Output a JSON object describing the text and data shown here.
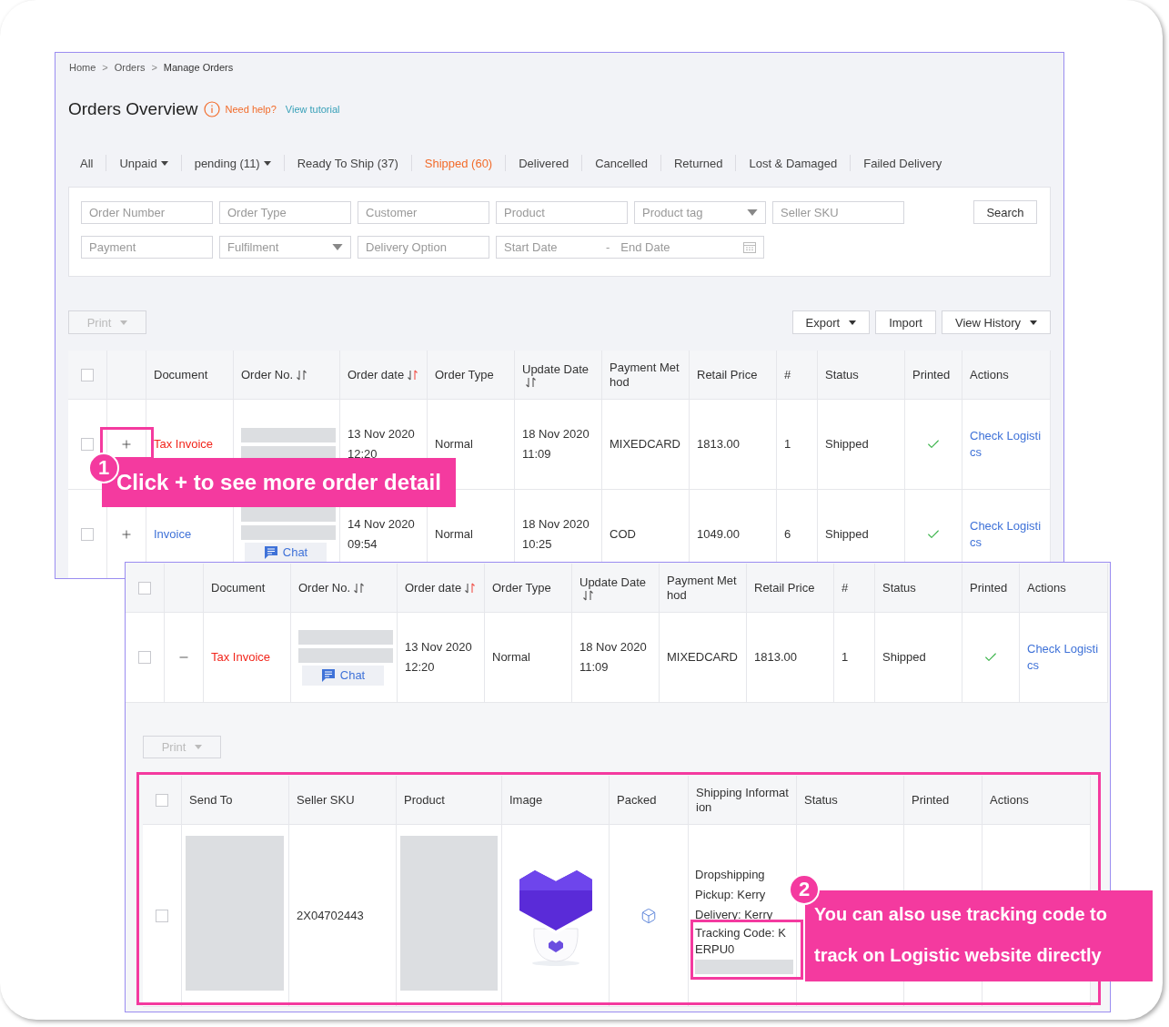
{
  "callouts": [
    {
      "number": "1",
      "text": "Click + to see more order detail"
    },
    {
      "number": "2",
      "text": "You can also use tracking code to track on Logistic website directly"
    }
  ],
  "orders_page": {
    "breadcrumb": [
      {
        "label": "Home",
        "kind": "link"
      },
      {
        "label": ">",
        "kind": "separator"
      },
      {
        "label": "Orders",
        "kind": "link"
      },
      {
        "label": ">",
        "kind": "separator"
      },
      {
        "label": "Manage Orders",
        "kind": "current"
      }
    ],
    "title": "Orders Overview",
    "help_text": "Need help?",
    "tutorial_link": "View tutorial",
    "tabs": [
      {
        "label": "All",
        "selected": false,
        "dropdown": false
      },
      {
        "label": "Unpaid",
        "selected": false,
        "dropdown": true
      },
      {
        "label": "pending (11)",
        "selected": false,
        "dropdown": true
      },
      {
        "label": "Ready To Ship (37)",
        "selected": false,
        "dropdown": false
      },
      {
        "label": "Shipped (60)",
        "selected": true,
        "dropdown": false
      },
      {
        "label": "Delivered",
        "selected": false,
        "dropdown": false
      },
      {
        "label": "Cancelled",
        "selected": false,
        "dropdown": false
      },
      {
        "label": "Returned",
        "selected": false,
        "dropdown": false
      },
      {
        "label": "Lost & Damaged",
        "selected": false,
        "dropdown": false
      },
      {
        "label": "Failed Delivery",
        "selected": false,
        "dropdown": false
      }
    ],
    "filters": [
      [
        {
          "kind": "text",
          "placeholder": "Order Number"
        },
        {
          "kind": "text",
          "placeholder": "Order Type"
        },
        {
          "kind": "text",
          "placeholder": "Customer"
        },
        {
          "kind": "text",
          "placeholder": "Product"
        },
        {
          "kind": "select",
          "placeholder": "Product tag"
        },
        {
          "kind": "text",
          "placeholder": "Seller SKU"
        }
      ],
      [
        {
          "kind": "text",
          "placeholder": "Payment"
        },
        {
          "kind": "select",
          "placeholder": "Fulfilment"
        },
        {
          "kind": "text",
          "placeholder": "Delivery Option"
        },
        {
          "kind": "date_range",
          "placeholder": "Start Date",
          "separator": "-",
          "end_placeholder": "End Date"
        }
      ]
    ],
    "search_button": "Search",
    "print_button": {
      "label": "Print",
      "disabled": true
    },
    "toolbar_buttons": [
      {
        "label": "Export",
        "dropdown": true
      },
      {
        "label": "Import",
        "dropdown": false
      },
      {
        "label": "View History",
        "dropdown": true
      }
    ],
    "table": {
      "columns": [
        {
          "kind": "checkbox",
          "checked": false
        },
        {
          "kind": "blank"
        },
        {
          "kind": "text",
          "label": "Document"
        },
        {
          "kind": "sortable",
          "label": "Order No.",
          "sorted": false
        },
        {
          "kind": "sortable",
          "label": "Order date",
          "sorted": true
        },
        {
          "kind": "text",
          "label": "Order Type"
        },
        {
          "kind": "sortable",
          "label": "Update Date",
          "sorted": false
        },
        {
          "kind": "text",
          "label": "Payment Method"
        },
        {
          "kind": "text",
          "label": "Retail Price"
        },
        {
          "kind": "text",
          "label": "#"
        },
        {
          "kind": "text",
          "label": "Status"
        },
        {
          "kind": "text",
          "label": "Printed"
        },
        {
          "kind": "text",
          "label": "Actions"
        }
      ],
      "rows": [
        {
          "checked": false,
          "expanded": false,
          "document": {
            "label": "Tax Invoice",
            "kind": "tax_invoice"
          },
          "order_date": [
            "13 Nov 2020",
            "12:20"
          ],
          "order_type": "Normal",
          "update_date": [
            "18 Nov 2020",
            "11:09"
          ],
          "payment": "MIXEDCARD",
          "price": "1813.00",
          "quantity": "1",
          "status": "Shipped",
          "printed": true,
          "action": "Check Logistics"
        },
        {
          "checked": false,
          "expanded": false,
          "document": {
            "label": "Invoice",
            "kind": "invoice"
          },
          "chat": "Chat",
          "order_date": [
            "14 Nov 2020",
            "09:54"
          ],
          "order_type": "Normal",
          "update_date": [
            "18 Nov 2020",
            "10:25"
          ],
          "payment": "COD",
          "price": "1049.00",
          "quantity": "6",
          "status": "Shipped",
          "printed": true,
          "action": "Check Logistics"
        }
      ]
    }
  },
  "expanded_view": {
    "table": {
      "columns": [
        {
          "kind": "checkbox",
          "checked": false
        },
        {
          "kind": "blank"
        },
        {
          "kind": "text",
          "label": "Document"
        },
        {
          "kind": "sortable",
          "label": "Order No.",
          "sorted": false
        },
        {
          "kind": "sortable",
          "label": "Order date",
          "sorted": true
        },
        {
          "kind": "text",
          "label": "Order Type"
        },
        {
          "kind": "sortable",
          "label": "Update Date",
          "sorted": false
        },
        {
          "kind": "text",
          "label": "Payment Method"
        },
        {
          "kind": "text",
          "label": "Retail Price"
        },
        {
          "kind": "text",
          "label": "#"
        },
        {
          "kind": "text",
          "label": "Status"
        },
        {
          "kind": "text",
          "label": "Printed"
        },
        {
          "kind": "text",
          "label": "Actions"
        }
      ],
      "rows": [
        {
          "checked": false,
          "expanded": true,
          "document": {
            "label": "Tax Invoice",
            "kind": "tax_invoice"
          },
          "chat": "Chat",
          "order_date": [
            "13 Nov 2020",
            "12:20"
          ],
          "order_type": "Normal",
          "update_date": [
            "18 Nov 2020",
            "11:09"
          ],
          "payment": "MIXEDCARD",
          "price": "1813.00",
          "quantity": "1",
          "status": "Shipped",
          "printed": true,
          "action": "Check Logistics"
        }
      ]
    },
    "print_button": {
      "label": "Print",
      "disabled": true
    },
    "items_table": {
      "columns": [
        {
          "kind": "checkbox",
          "checked": false
        },
        {
          "kind": "text",
          "label": "Send To"
        },
        {
          "kind": "text",
          "label": "Seller SKU"
        },
        {
          "kind": "text",
          "label": "Product"
        },
        {
          "kind": "text",
          "label": "Image"
        },
        {
          "kind": "text",
          "label": "Packed"
        },
        {
          "kind": "text",
          "label": "Shipping Information"
        },
        {
          "kind": "text",
          "label": "Status"
        },
        {
          "kind": "text",
          "label": "Printed"
        },
        {
          "kind": "text",
          "label": "Actions"
        }
      ],
      "rows": [
        {
          "checked": false,
          "seller_sku": "2X04702443",
          "image": {
            "kind": "picture"
          },
          "packed": true,
          "shipping_info": [
            "Dropshipping",
            "Pickup: Kerry",
            "Delivery: Kerry"
          ],
          "tracking_code": "Tracking Code: KERPU0"
        }
      ]
    }
  }
}
